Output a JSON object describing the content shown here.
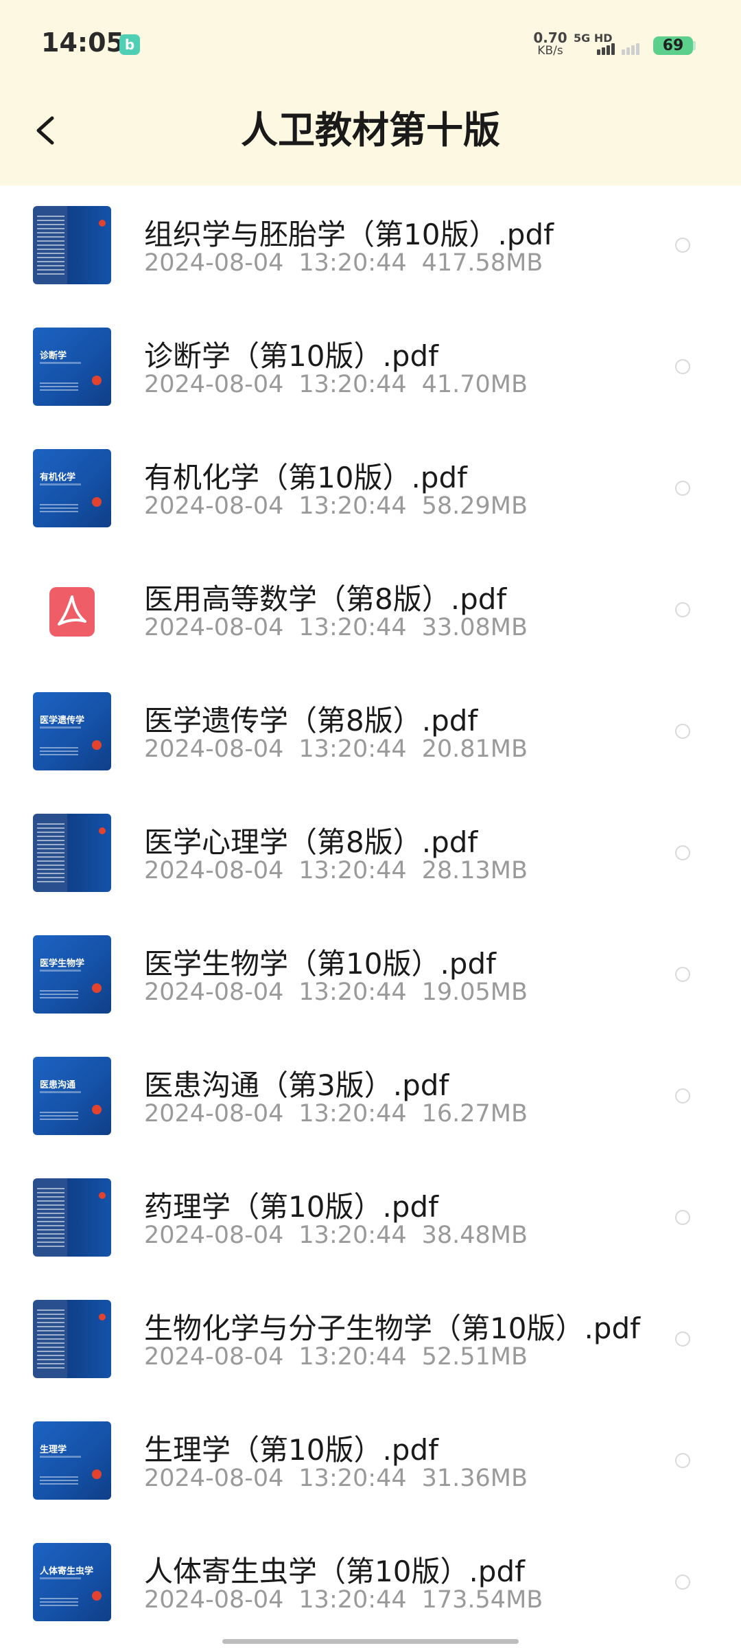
{
  "status_bar": {
    "time": "14:05",
    "app_icon_glyph": "b",
    "net_speed_value": "0.70",
    "net_speed_unit": "KB/s",
    "net_type": "5G HD",
    "battery": "69"
  },
  "header": {
    "title": "人卫教材第十版",
    "back_icon": "chevron-left-icon"
  },
  "colors": {
    "header_bg": "#fdf8e1",
    "meta_text": "#9a9a9a",
    "pdf_icon": "#ef5e67",
    "cover_blue": "#1552a9",
    "battery": "#5dcf8c"
  },
  "files": [
    {
      "name": "组织学与胚胎学（第10版）.pdf",
      "date": "2024-08-04",
      "time": "13:20:44",
      "size": "417.58MB",
      "thumb": "spine",
      "cover_label": ""
    },
    {
      "name": "诊断学（第10版）.pdf",
      "date": "2024-08-04",
      "time": "13:20:44",
      "size": "41.70MB",
      "thumb": "cover",
      "cover_label": "诊断学"
    },
    {
      "name": "有机化学（第10版）.pdf",
      "date": "2024-08-04",
      "time": "13:20:44",
      "size": "58.29MB",
      "thumb": "cover",
      "cover_label": "有机化学"
    },
    {
      "name": "医用高等数学（第8版）.pdf",
      "date": "2024-08-04",
      "time": "13:20:44",
      "size": "33.08MB",
      "thumb": "pdf",
      "cover_label": ""
    },
    {
      "name": "医学遗传学（第8版）.pdf",
      "date": "2024-08-04",
      "time": "13:20:44",
      "size": "20.81MB",
      "thumb": "cover",
      "cover_label": "医学遗传学"
    },
    {
      "name": "医学心理学（第8版）.pdf",
      "date": "2024-08-04",
      "time": "13:20:44",
      "size": "28.13MB",
      "thumb": "spine",
      "cover_label": ""
    },
    {
      "name": "医学生物学（第10版）.pdf",
      "date": "2024-08-04",
      "time": "13:20:44",
      "size": "19.05MB",
      "thumb": "cover",
      "cover_label": "医学生物学"
    },
    {
      "name": "医患沟通（第3版）.pdf",
      "date": "2024-08-04",
      "time": "13:20:44",
      "size": "16.27MB",
      "thumb": "cover",
      "cover_label": "医患沟通"
    },
    {
      "name": "药理学（第10版）.pdf",
      "date": "2024-08-04",
      "time": "13:20:44",
      "size": "38.48MB",
      "thumb": "spine",
      "cover_label": ""
    },
    {
      "name": "生物化学与分子生物学（第10版）.pdf",
      "date": "2024-08-04",
      "time": "13:20:44",
      "size": "52.51MB",
      "thumb": "spine",
      "cover_label": ""
    },
    {
      "name": "生理学（第10版）.pdf",
      "date": "2024-08-04",
      "time": "13:20:44",
      "size": "31.36MB",
      "thumb": "cover",
      "cover_label": "生理学"
    },
    {
      "name": "人体寄生虫学（第10版）.pdf",
      "date": "2024-08-04",
      "time": "13:20:44",
      "size": "173.54MB",
      "thumb": "cover",
      "cover_label": "人体寄生虫学"
    }
  ]
}
